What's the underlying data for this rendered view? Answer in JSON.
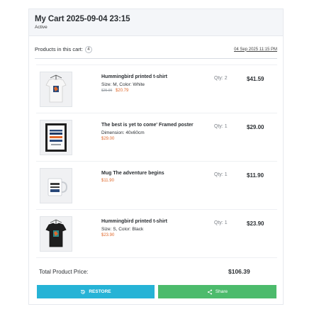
{
  "cart": {
    "title": "My Cart 2025-09-04 23:15",
    "status": "Active"
  },
  "products_bar": {
    "label": "Products in this cart:",
    "count": "4",
    "date": "04 Sep 2025 11:15 PM"
  },
  "items": [
    {
      "name": "Hummingbird printed t-shirt",
      "attributes": "Size: M, Color: White",
      "old_price": "$25.99",
      "price": "$20.79",
      "qty": "Qty: 2",
      "total": "$41.59",
      "thumb": "white-tshirt"
    },
    {
      "name": "The best is yet to come' Framed poster",
      "attributes": "Dimension: 40x60cm",
      "old_price": "",
      "price": "$29.00",
      "qty": "Qty: 1",
      "total": "$29.00",
      "thumb": "framed-poster"
    },
    {
      "name": "Mug The adventure begins",
      "attributes": "",
      "old_price": "",
      "price": "$11.90",
      "qty": "Qty: 1",
      "total": "$11.90",
      "thumb": "mug"
    },
    {
      "name": "Hummingbird printed t-shirt",
      "attributes": "Size: S, Color: Black",
      "old_price": "",
      "price": "$23.90",
      "qty": "Qty: 1",
      "total": "$23.90",
      "thumb": "black-tshirt"
    }
  ],
  "summary": {
    "label": "Total Product Price:",
    "value": "$106.39"
  },
  "actions": {
    "restore_label": "RESTORE",
    "restore_icon": "history-icon",
    "share_label": "Share",
    "share_icon": "share-icon"
  },
  "colors": {
    "restore": "#26b3d6",
    "share": "#4cbb6c",
    "price": "#e0682a"
  }
}
